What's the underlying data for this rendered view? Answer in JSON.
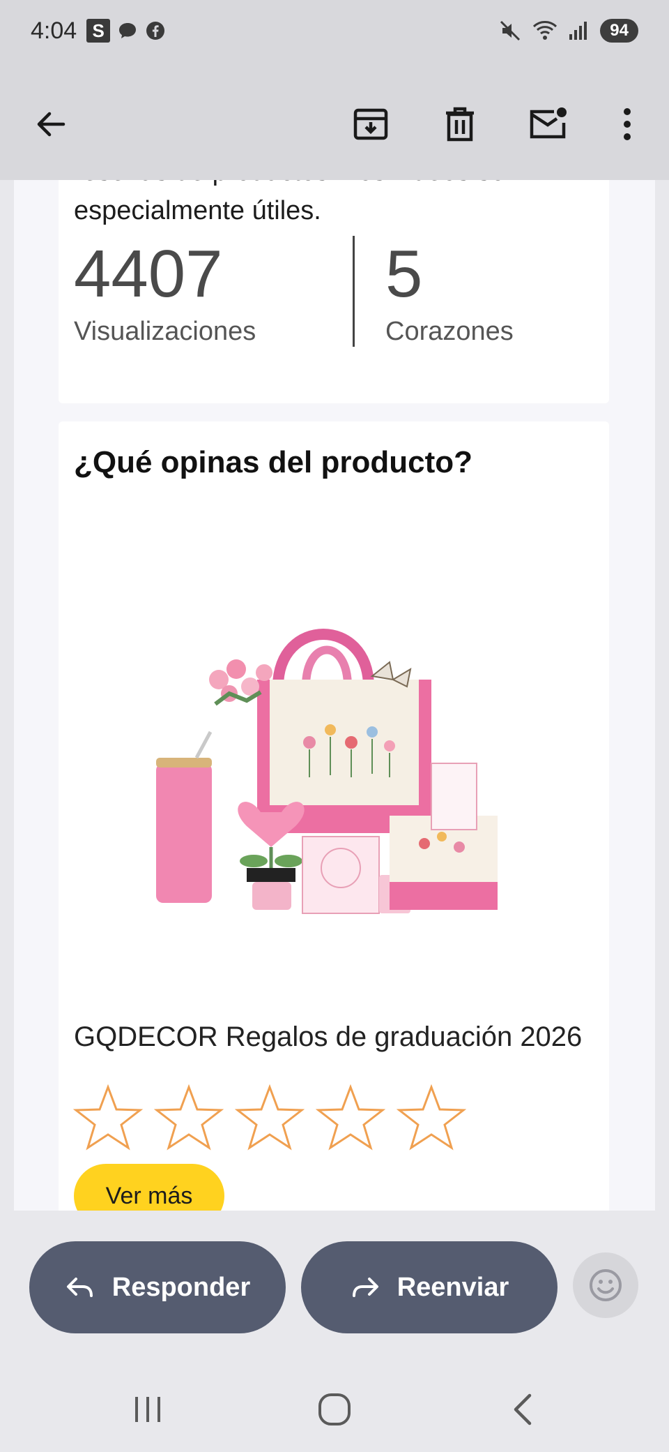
{
  "status_bar": {
    "time": "4:04",
    "s_badge": "S",
    "battery": "94"
  },
  "email": {
    "intro_partial_line1": "reseñas de productos. Los videos son",
    "intro_partial_line2": "especialmente útiles.",
    "stats": [
      {
        "value": "4407",
        "label": "Visualizaciones"
      },
      {
        "value": "5",
        "label": "Corazones"
      }
    ],
    "review_card": {
      "title": "¿Qué opinas del producto?",
      "product_name": "GQDECOR Regalos de graduación 2026",
      "rating_stars_total": 5,
      "rating_selected": 0,
      "star_color": "#f0a050",
      "cta_label": "Ver más",
      "cta_color": "#ffd21f"
    }
  },
  "actions": {
    "reply_label": "Responder",
    "forward_label": "Reenviar"
  },
  "colors": {
    "pill": "#555c70",
    "background": "#e8e8ec",
    "bar": "#d8d8dc"
  }
}
